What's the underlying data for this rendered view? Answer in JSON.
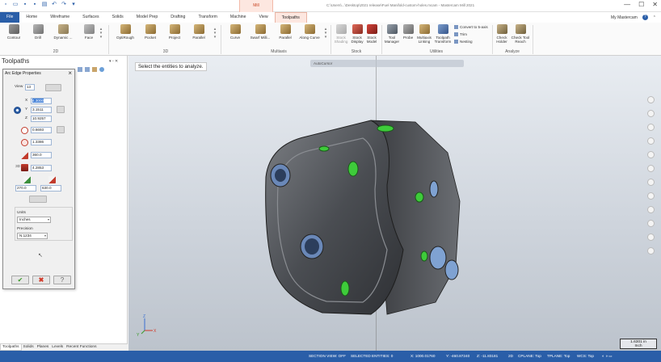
{
  "title_bar": {
    "context_tab": "Mill",
    "window_title": "C:\\Users\\...\\Desktop\\2021 release\\Fuel Manifold-custom-holes.mcam - Mastercam Mill 2021",
    "controls": [
      "—",
      "☐",
      "✕"
    ]
  },
  "tabs": [
    "File",
    "Home",
    "Wireframe",
    "Surfaces",
    "Solids",
    "Model Prep",
    "Drafting",
    "Transform",
    "Machine",
    "View",
    "Toolpaths"
  ],
  "active_tab": "Toolpaths",
  "user": "My Mastercam",
  "ribbon": {
    "contour": "Contour",
    "drill": "Drill",
    "dynamic": "Dynamic ...",
    "face": "Face",
    "optirough": "OptiRough",
    "pocket": "Pocket",
    "project": "Project",
    "parallel": "Parallel",
    "curve": "Curve",
    "swarf": "Swarf Milli...",
    "parallel5": "Parallel",
    "along_curve": "Along Curve",
    "stock_shading": "Stock Shading",
    "stock_display": "Stock Display",
    "stock_model": "Stock Model",
    "tool_manager": "Tool Manager",
    "probe": "Probe",
    "multiaxis_linking": "Multiaxis Linking",
    "toolpath_transform": "Toolpath Transform",
    "convert_5axis": "Convert to 5-axis",
    "trim": "Trim",
    "nesting": "Nesting",
    "check_holder": "Check Holder",
    "check_tool_reach": "Check Tool Reach",
    "groups": {
      "g2d": "2D",
      "g3d": "3D",
      "multiaxis": "Multiaxis",
      "stock": "Stock",
      "utilities": "Utilities",
      "analyze": "Analyze"
    }
  },
  "left_panel": {
    "title": "Toolpaths",
    "controls": "▾ ▫ ✕"
  },
  "dialog": {
    "title": "Arc Edge Properties",
    "view_label": "View",
    "view_value": "13",
    "x_label": "X",
    "x_value": "4.3000",
    "y_label": "Y",
    "y_value": "3.1511",
    "z_label": "Z",
    "z_value": "10.9257",
    "diameter_value": "0.6693",
    "radius_value": "1.3386",
    "sweep_value": "360.0",
    "depth_value": "4.2853",
    "angle1_value": "270.0",
    "angle2_value": "630.0",
    "units_label": "Units",
    "units_value": "Inches",
    "precision_label": "Precision",
    "precision_value": "N.1234"
  },
  "bottom_tabs": [
    "Toolpaths",
    "Solids",
    "Planes",
    "Levels",
    "Recent Functions"
  ],
  "viewport": {
    "prompt": "Select the entities to analyze.",
    "toolbar": "AutoCursor",
    "scale_value": "1.6301 in",
    "scale_unit": "Inch"
  },
  "status": {
    "section_view": "SECTION VIEW: OFF",
    "selected": "SELECTED ENTITIES: 0",
    "x": "X:  1000.01760",
    "y": "Y:  -460.87240",
    "z": "Z:  -11.83181",
    "mode": "2D",
    "cplane": "CPLANE: Top",
    "tplane": "TPLANE: Top",
    "wcs": "WCS: Top"
  },
  "colors": {
    "accent_blue": "#2a5ea8",
    "context_tab_bg": "#fde7e0",
    "context_tab_text": "#c94420",
    "hole_green": "#3ecb3a"
  }
}
